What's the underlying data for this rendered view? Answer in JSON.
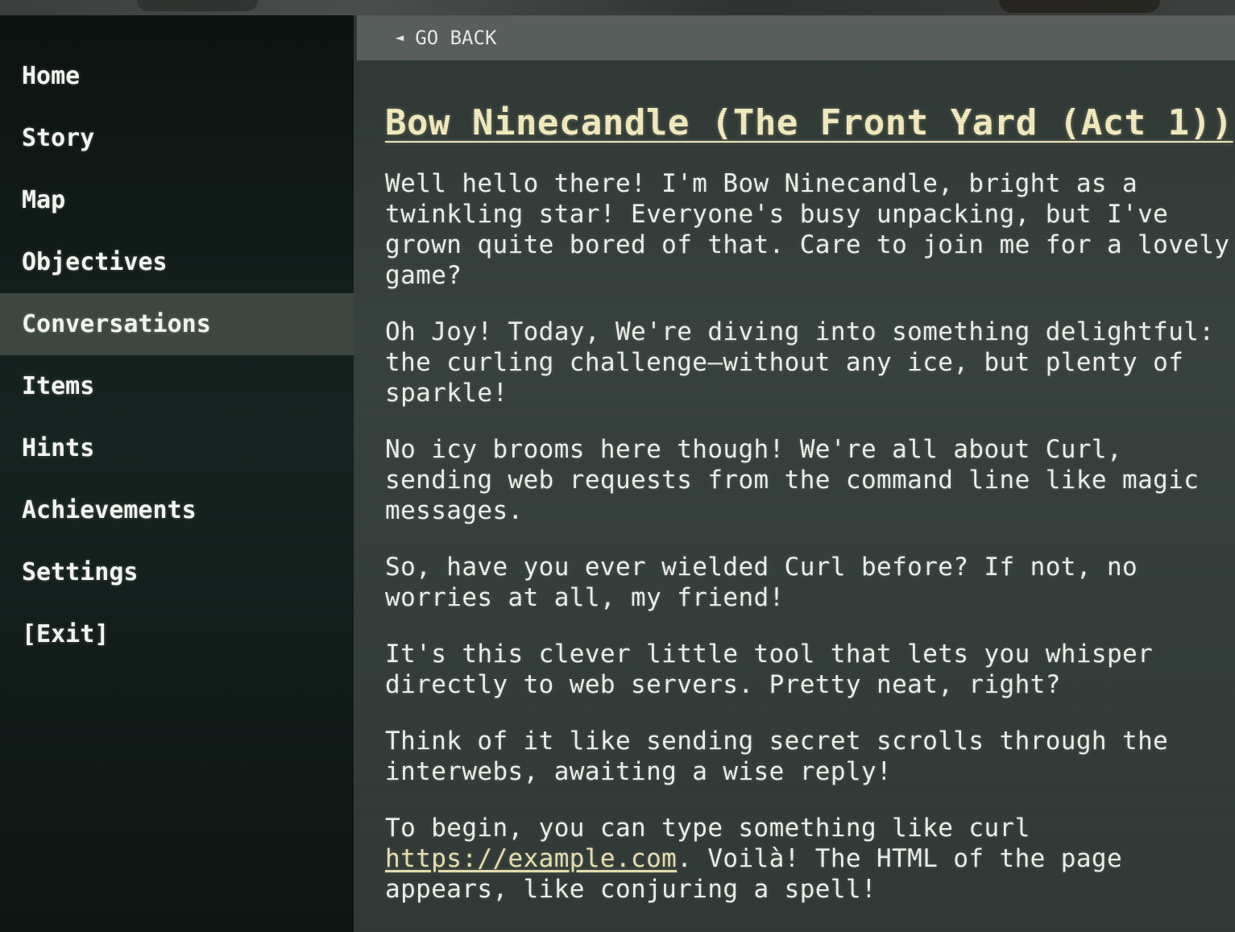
{
  "sidebar": {
    "items": [
      {
        "label": "Home"
      },
      {
        "label": "Story"
      },
      {
        "label": "Map"
      },
      {
        "label": "Objectives"
      },
      {
        "label": "Conversations",
        "active": true
      },
      {
        "label": "Items"
      },
      {
        "label": "Hints"
      },
      {
        "label": "Achievements"
      },
      {
        "label": "Settings"
      },
      {
        "label": "[Exit]"
      }
    ]
  },
  "back": {
    "arrow_icon": "left-triangle-icon",
    "label": "GO BACK"
  },
  "conversation": {
    "title": "Bow Ninecandle (The Front Yard (Act 1))",
    "paragraphs": [
      "Well hello there! I'm Bow Ninecandle, bright as a twinkling star! Everyone's busy unpacking, but I've grown quite bored of that. Care to join me for a lovely game?",
      "Oh Joy! Today, We're diving into something delightful: the curling challenge—without any ice, but plenty of sparkle!",
      "No icy brooms here though! We're all about Curl, sending web requests from the command line like magic messages.",
      "So, have you ever wielded Curl before? If not, no worries at all, my friend!",
      "It's this clever little tool that lets you whisper directly to web servers. Pretty neat, right?",
      "Think of it like sending secret scrolls through the interwebs, awaiting a wise reply!"
    ],
    "last_paragraph": {
      "before_link": "To begin, you can type something like curl ",
      "link": "https://example.com",
      "after_link": ". Voilà! The HTML of the page appears, like conjuring a spell!"
    }
  },
  "colors": {
    "title": "#f4ecbf",
    "active_nav": "#3e4642",
    "back_bar": "#5a605d"
  }
}
